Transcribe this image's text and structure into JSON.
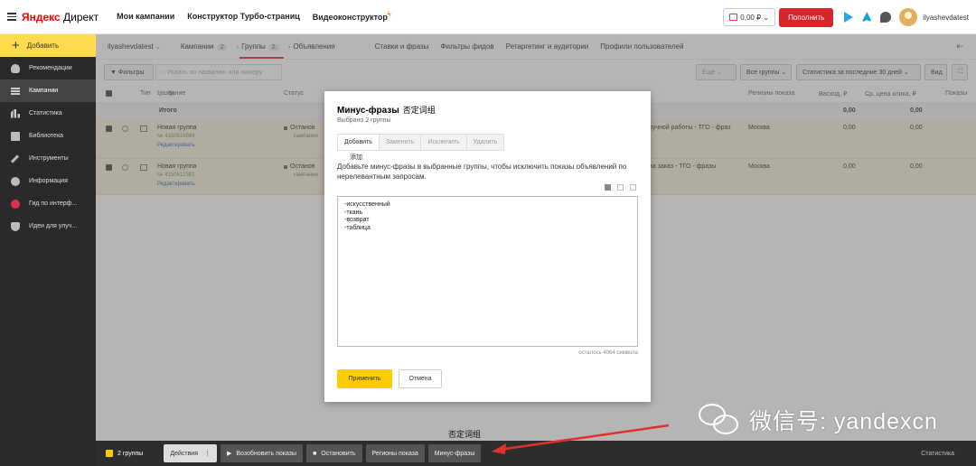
{
  "header": {
    "logo_brand": "Яндекс",
    "logo_product": "Директ",
    "nav": [
      "Мои кампании",
      "Конструктор Турбо-страниц",
      "Видеоконструктор"
    ],
    "balance": "0,00 ₽",
    "balance_caret": "⌄",
    "pay_label": "Пополнить",
    "username": "ilyashevdatest"
  },
  "sidebar": {
    "add_label": "Добавить",
    "items": [
      {
        "label": "Рекомендации",
        "icon": "bulb-icon"
      },
      {
        "label": "Кампании",
        "icon": "list-icon"
      },
      {
        "label": "Статистика",
        "icon": "bar-chart-icon"
      },
      {
        "label": "Библиотека",
        "icon": "library-icon"
      },
      {
        "label": "Инструменты",
        "icon": "wrench-icon"
      },
      {
        "label": "Информация",
        "icon": "info-icon"
      },
      {
        "label": "Гид по интерф...",
        "icon": "guide-icon"
      },
      {
        "label": "Идеи для улуч...",
        "icon": "thumb-up-icon"
      }
    ]
  },
  "breadcrumbs": {
    "account": "ilyashevdatest",
    "campaigns": "Кампании",
    "campaigns_count": "2",
    "groups": "Группы",
    "groups_count": "2",
    "ads": "Объявления",
    "extra_tabs": [
      "Ставки и фразы",
      "Фильтры фидов",
      "Ретаргетинг и аудитории",
      "Профили пользователей"
    ],
    "collapse": "⇤"
  },
  "toolbar": {
    "filters": "Фильтры",
    "search_placeholder": "Искать по названию или номеру",
    "more": "Ещё",
    "all_groups": "Все группы",
    "stats_period": "Статистика за последние 30 дней",
    "view": "Вид"
  },
  "table": {
    "headers": {
      "type": "Тип",
      "name": "Название",
      "number": "№",
      "status": "Статус",
      "regions": "Регионы показа",
      "spend": "Расход, ₽",
      "avg_cpc": "Ср. цена клика, ₽",
      "impressions": "Показы"
    },
    "total": {
      "label": "Итого",
      "spend": "0,00",
      "avg_cpc": "0,00"
    },
    "rows": [
      {
        "name": "Новая группа",
        "id": "№ 4150616594",
        "edit": "Редактировать",
        "status": "Останов",
        "status_sub": "кампания",
        "phrase": "ручной работы - ТГО - фраз",
        "region": "Москва",
        "spend": "0,00",
        "avg_cpc": "0,00"
      },
      {
        "name": "Новая группа",
        "id": "№ 4150612582",
        "edit": "Редактировать",
        "status": "Останов",
        "status_sub": "кампания",
        "phrase": "на заказ - ТГО - фразы",
        "region": "Москва",
        "spend": "0,00",
        "avg_cpc": "0,00"
      }
    ]
  },
  "modal": {
    "title": "Минус-фразы",
    "title_cn": "否定词组",
    "subtitle": "Выбрано 2 группы",
    "tabs": [
      "Добавить",
      "Заменить",
      "Исключить",
      "Удалить"
    ],
    "tab_note": "添加",
    "description": "Добавьте минус-фразы в выбранные группы, чтобы исключить показы объявлений по нерелевантным запросам.",
    "phrases": "-искусственный\n-ткань\n-возврат\n-таблица",
    "remaining": "осталось 4064 символа",
    "apply": "Применить",
    "cancel": "Отмена"
  },
  "annotation": "否定词组",
  "bottombar": {
    "selected": "2 группы",
    "actions": "Действия",
    "resume": "Возобновить показы",
    "stop": "Остановить",
    "regions": "Регионы показа",
    "minus": "Минус-фразы",
    "stats": "Статистика"
  },
  "watermark": "微信号: yandexcn",
  "colors": {
    "accent_yellow": "#ffcc00",
    "pay_red": "#d6262b",
    "arrow_red": "#e0322d",
    "row_highlight": "#f6efd9"
  }
}
